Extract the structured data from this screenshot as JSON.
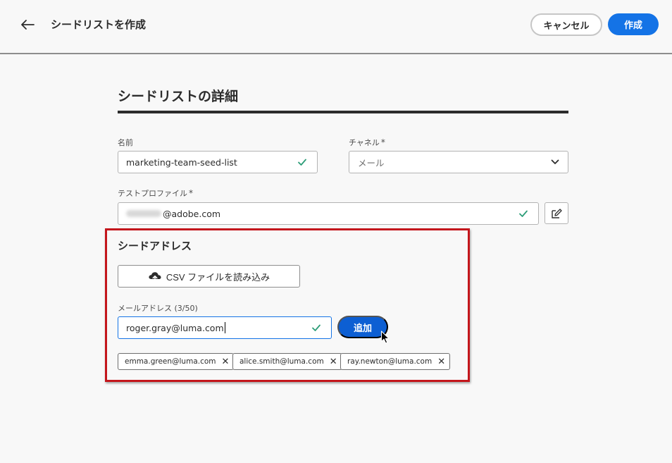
{
  "header": {
    "title": "シードリストを作成",
    "cancel_label": "キャンセル",
    "create_label": "作成"
  },
  "details": {
    "section_title": "シードリストの詳細",
    "name_label": "名前",
    "name_value": "marketing-team-seed-list",
    "channel_label": "チャネル",
    "channel_required": "*",
    "channel_value": "メール",
    "test_profile_label": "テストプロファイル",
    "test_profile_required": "*",
    "test_profile_value": "@adobe.com"
  },
  "seed": {
    "section_title": "シードアドレス",
    "csv_label": "CSV ファイルを読み込み",
    "email_label": "メールアドレス (3/50)",
    "email_value": "roger.gray@luma.com",
    "add_label": "追加",
    "tags": [
      {
        "label": "emma.green@luma.com"
      },
      {
        "label": "alice.smith@luma.com"
      },
      {
        "label": "ray.newton@luma.com"
      }
    ]
  },
  "colors": {
    "accent": "#1473e6",
    "highlight": "#c4161c",
    "check": "#2d9d78"
  }
}
